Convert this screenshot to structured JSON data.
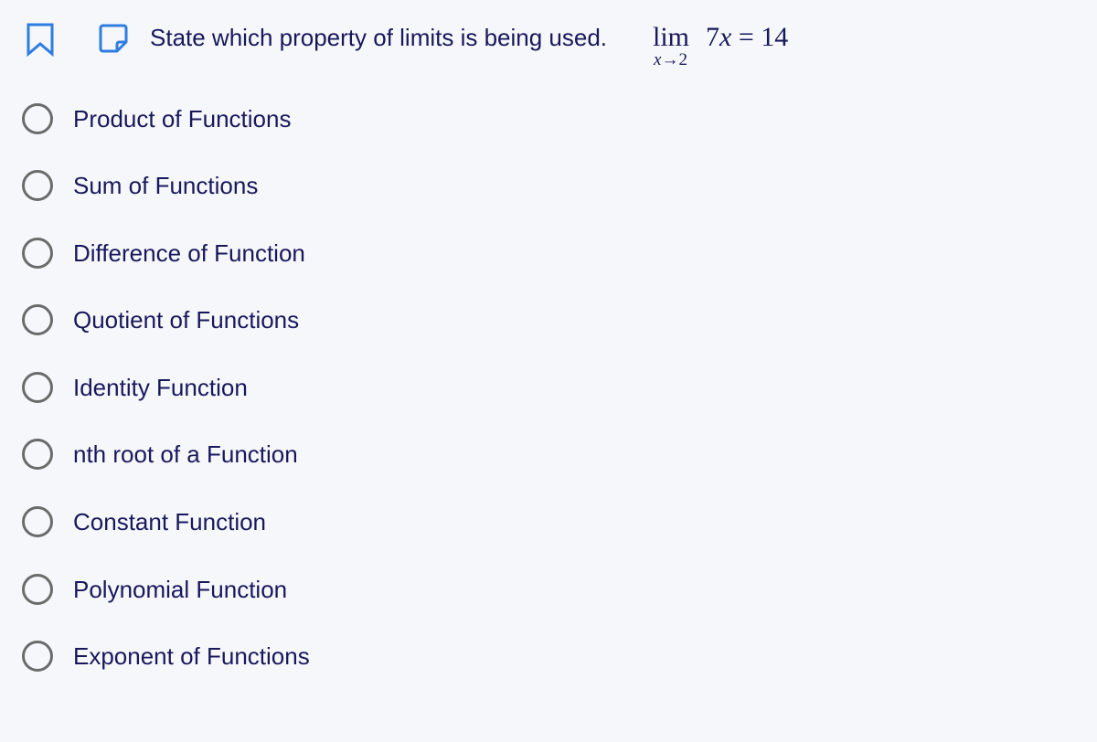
{
  "question": {
    "text": "State which property of limits is being used.",
    "math": {
      "operator": "lim",
      "subscript_var": "x",
      "subscript_arrow": "→",
      "subscript_value": "2",
      "coefficient": "7",
      "variable": "x",
      "equals": "=",
      "result": "14"
    }
  },
  "icons": {
    "bookmark": "bookmark-icon",
    "note": "note-icon",
    "accent_color": "#2f7de1",
    "bookmark_color": "#2f7de1",
    "radio_border_color": "#6b6b6b",
    "text_color": "#18185b"
  },
  "options": [
    {
      "label": "Product of Functions",
      "selected": false
    },
    {
      "label": "Sum of Functions",
      "selected": false
    },
    {
      "label": "Difference of Function",
      "selected": false
    },
    {
      "label": "Quotient of Functions",
      "selected": false
    },
    {
      "label": "Identity Function",
      "selected": false
    },
    {
      "label": "nth root of a Function",
      "selected": false
    },
    {
      "label": "Constant Function",
      "selected": false
    },
    {
      "label": "Polynomial Function",
      "selected": false
    },
    {
      "label": "Exponent of Functions",
      "selected": false
    }
  ]
}
